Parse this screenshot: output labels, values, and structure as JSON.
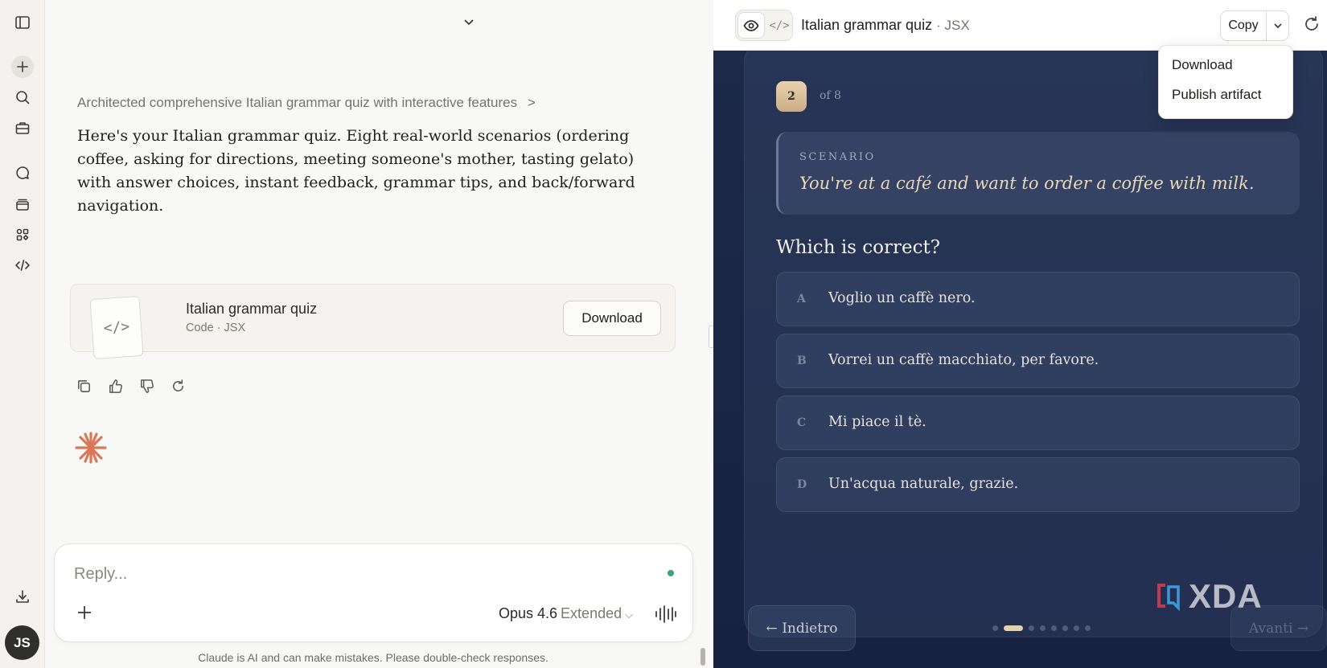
{
  "sidebar": {
    "icons": [
      "sidebar-toggle-icon",
      "new-chat-icon",
      "search-icon",
      "projects-icon",
      "chats-icon",
      "artifacts-icon",
      "apps-icon",
      "code-icon",
      "download-app-icon"
    ],
    "avatar_initials": "JS"
  },
  "chat": {
    "thinking_summary": "Architected comprehensive Italian grammar quiz with interactive features",
    "thinking_chevron": ">",
    "message": "Here's your Italian grammar quiz. Eight real-world scenarios (ordering coffee, asking for directions, meeting someone's mother, tasting gelato) with answer choices, instant feedback, grammar tips, and back/forward navigation.",
    "artifact": {
      "title": "Italian grammar quiz",
      "subtitle": "Code · JSX",
      "thumb_glyph": "</>",
      "download_label": "Download"
    },
    "composer": {
      "placeholder": "Reply...",
      "model": "Opus 4.6",
      "mode": "Extended"
    },
    "disclaimer": "Claude is AI and can make mistakes. Please double-check responses."
  },
  "panel": {
    "title": "Italian grammar quiz",
    "lang": "· JSX",
    "code_toggle_glyph": "</>",
    "copy_label": "Copy",
    "menu": {
      "download": "Download",
      "publish": "Publish artifact"
    }
  },
  "quiz": {
    "number": "2",
    "of_label": "of 8",
    "scenario_label": "SCENARIO",
    "scenario_text": "You're at a café and want to order a coffee with milk.",
    "question": "Which is correct?",
    "options": [
      {
        "letter": "A",
        "text": "Voglio un caffè nero."
      },
      {
        "letter": "B",
        "text": "Vorrei un caffè macchiato, per favore."
      },
      {
        "letter": "C",
        "text": "Mi piace il tè."
      },
      {
        "letter": "D",
        "text": "Un'acqua naturale, grazie."
      }
    ],
    "back_label": "← Indietro",
    "next_label": "Avanti →",
    "total_steps": 8,
    "current_step": 2
  },
  "watermark": "XDA",
  "colors": {
    "accent_orange": "#d97757",
    "quiz_bg": "#1d2a4a",
    "gold": "#e4d2b0",
    "status_green": "#3aa57a"
  }
}
